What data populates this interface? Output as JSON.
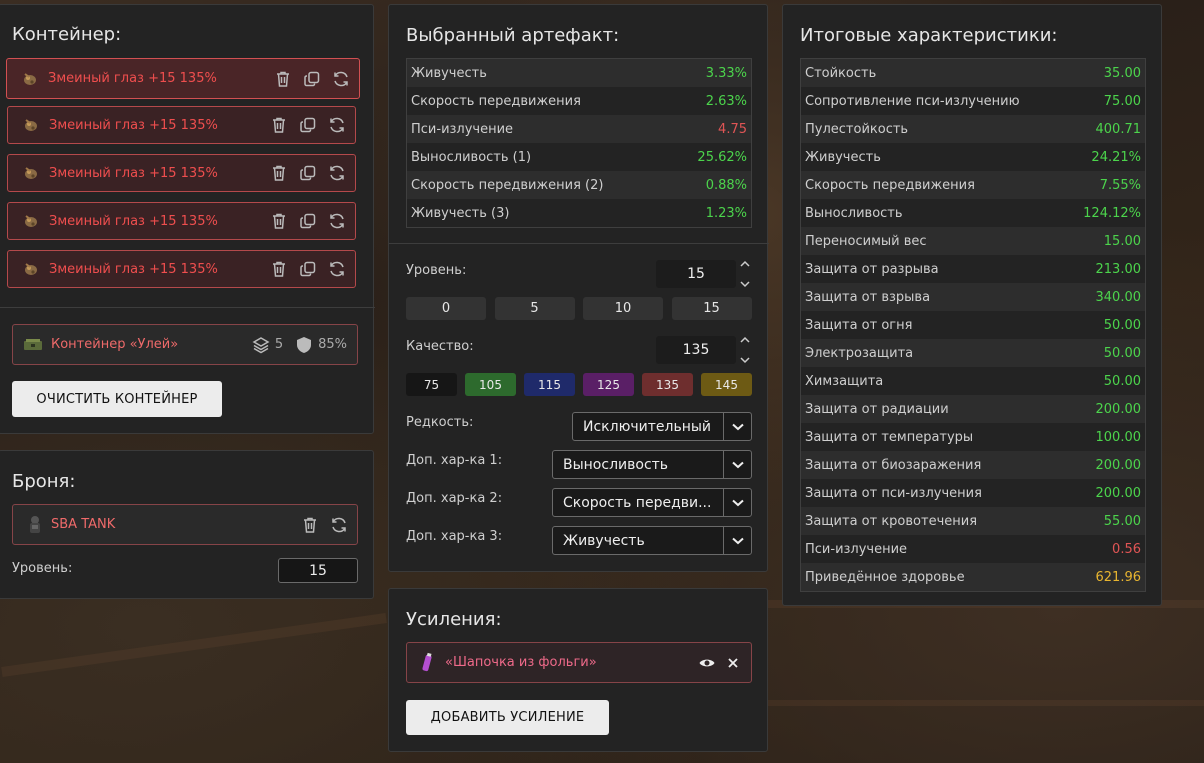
{
  "container_panel": {
    "title": "Контейнер:",
    "artifacts": [
      {
        "label": "Змеиный глаз +15 135%",
        "selected": true
      },
      {
        "label": "Змеиный глаз +15 135%",
        "selected": false
      },
      {
        "label": "Змеиный глаз +15 135%",
        "selected": false
      },
      {
        "label": "Змеиный глаз +15 135%",
        "selected": false
      },
      {
        "label": "Змеиный глаз +15 135%",
        "selected": false
      }
    ],
    "container": {
      "name": "Контейнер «Улей»",
      "slots": "5",
      "protection": "85%"
    },
    "clear_button": "ОЧИСТИТЬ КОНТЕЙНЕР"
  },
  "armor_panel": {
    "title": "Броня:",
    "armor_name": "SBA TANK",
    "level_label": "Уровень:",
    "level_value": "15"
  },
  "artifact_panel": {
    "title": "Выбранный артефакт:",
    "stats": [
      {
        "label": "Живучесть",
        "value": "3.33%",
        "color": "#4cd44c"
      },
      {
        "label": "Скорость передвижения",
        "value": "2.63%",
        "color": "#4cd44c"
      },
      {
        "label": "Пси-излучение",
        "value": "4.75",
        "color": "#e05555"
      },
      {
        "label": "Выносливость (1)",
        "value": "25.62%",
        "color": "#4cd44c"
      },
      {
        "label": "Скорость передвижения (2)",
        "value": "0.88%",
        "color": "#4cd44c"
      },
      {
        "label": "Живучесть (3)",
        "value": "1.23%",
        "color": "#4cd44c"
      }
    ],
    "level_label": "Уровень:",
    "level_value": "15",
    "level_presets": [
      "0",
      "5",
      "10",
      "15"
    ],
    "quality_label": "Качество:",
    "quality_value": "135",
    "quality_presets": [
      {
        "label": "75",
        "color": "#161616"
      },
      {
        "label": "105",
        "color": "#2d6a2d"
      },
      {
        "label": "115",
        "color": "#1f2a6a"
      },
      {
        "label": "125",
        "color": "#5a1f66"
      },
      {
        "label": "135",
        "color": "#6e2e2e"
      },
      {
        "label": "145",
        "color": "#6d5a14"
      }
    ],
    "rarity_label": "Редкость:",
    "rarity_value": "Исключительный",
    "extra1_label": "Доп. хар-ка 1:",
    "extra1_value": "Выносливость",
    "extra2_label": "Доп. хар-ка 2:",
    "extra2_value": "Скорость передви...",
    "extra3_label": "Доп. хар-ка 3:",
    "extra3_value": "Живучесть"
  },
  "boosts_panel": {
    "title": "Усиления:",
    "boost_name": "«Шапочка из фольги»",
    "add_button": "ДОБАВИТЬ УСИЛЕНИЕ"
  },
  "totals_panel": {
    "title": "Итоговые характеристики:",
    "stats": [
      {
        "label": "Стойкость",
        "value": "35.00",
        "color": "#4cd44c"
      },
      {
        "label": "Сопротивление пси-излучению",
        "value": "75.00",
        "color": "#4cd44c"
      },
      {
        "label": "Пулестойкость",
        "value": "400.71",
        "color": "#4cd44c"
      },
      {
        "label": "Живучесть",
        "value": "24.21%",
        "color": "#4cd44c"
      },
      {
        "label": "Скорость передвижения",
        "value": "7.55%",
        "color": "#4cd44c"
      },
      {
        "label": "Выносливость",
        "value": "124.12%",
        "color": "#4cd44c"
      },
      {
        "label": "Переносимый вес",
        "value": "15.00",
        "color": "#4cd44c"
      },
      {
        "label": "Защита от разрыва",
        "value": "213.00",
        "color": "#4cd44c"
      },
      {
        "label": "Защита от взрыва",
        "value": "340.00",
        "color": "#4cd44c"
      },
      {
        "label": "Защита от огня",
        "value": "50.00",
        "color": "#4cd44c"
      },
      {
        "label": "Электрозащита",
        "value": "50.00",
        "color": "#4cd44c"
      },
      {
        "label": "Химзащита",
        "value": "50.00",
        "color": "#4cd44c"
      },
      {
        "label": "Защита от радиации",
        "value": "200.00",
        "color": "#4cd44c"
      },
      {
        "label": "Защита от температуры",
        "value": "100.00",
        "color": "#4cd44c"
      },
      {
        "label": "Защита от биозаражения",
        "value": "200.00",
        "color": "#4cd44c"
      },
      {
        "label": "Защита от пси-излучения",
        "value": "200.00",
        "color": "#4cd44c"
      },
      {
        "label": "Защита от кровотечения",
        "value": "55.00",
        "color": "#4cd44c"
      },
      {
        "label": "Пси-излучение",
        "value": "0.56",
        "color": "#e05555"
      },
      {
        "label": "Приведённое здоровье",
        "value": "621.96",
        "color": "#e8b530"
      }
    ]
  }
}
